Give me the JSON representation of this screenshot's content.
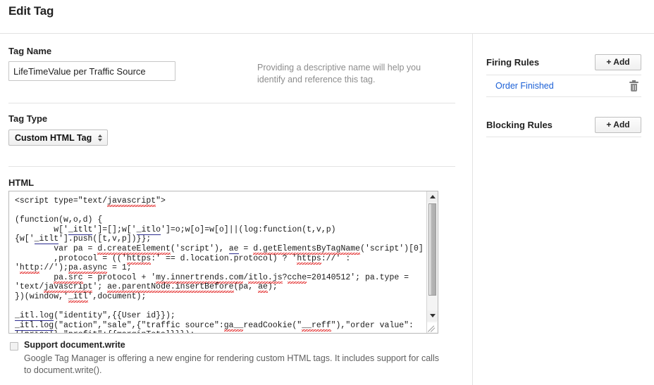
{
  "page": {
    "title": "Edit Tag"
  },
  "form": {
    "tag_name": {
      "label": "Tag Name",
      "value": "LifeTimeValue per Traffic Source",
      "placeholder": "",
      "help": "Providing a descriptive name will help you identify and reference this tag."
    },
    "tag_type": {
      "label": "Tag Type",
      "selected": "Custom HTML Tag",
      "options": [
        "Custom HTML Tag"
      ]
    },
    "html": {
      "label": "HTML",
      "code": "<script type=\"text/javascript\">\n\n(function(w,o,d) {\n        w['_itlt']=[];w['_itlo']=o;w[o]=w[o]||(log:function(t,v,p)\n{w['_itlt'].push([t,v,p])}};\n        var pa = d.createElement('script'), ae = d.getElementsByTagName('script')[0]\n        ,protocol = (('https:' == d.location.protocol) ? 'https://' :\n'http://');pa.async = 1;\n        pa.src = protocol + 'my.innertrends.com/itlo.js?cche=20140512'; pa.type =\n'text/javascript'; ae.parentNode.insertBefore(pa, ae);\n})(window,'_itl',document);\n\n_itl.log(\"identity\",{{User id}});\n_itl.log(\"action\",\"sale\",{\"traffic source\":ga__readCookie(\"__reff\"),\"order value\":\n{{price}},\"profit\":{{marginTotal}}});"
    },
    "support_document_write": {
      "label": "Support document.write",
      "description": "Google Tag Manager is offering a new engine for rendering custom HTML tags. It includes support for calls to document.write().",
      "checked": false
    }
  },
  "sidebar": {
    "firing_rules": {
      "title": "Firing Rules",
      "add_label": "+ Add",
      "rules": [
        {
          "name": "Order Finished"
        }
      ]
    },
    "blocking_rules": {
      "title": "Blocking Rules",
      "add_label": "+ Add",
      "rules": []
    }
  },
  "colors": {
    "link": "#1a5fd6",
    "help_text": "#8d8d8d",
    "border": "#e2e2e2",
    "spellcheck_underline": "#e01b1b"
  }
}
